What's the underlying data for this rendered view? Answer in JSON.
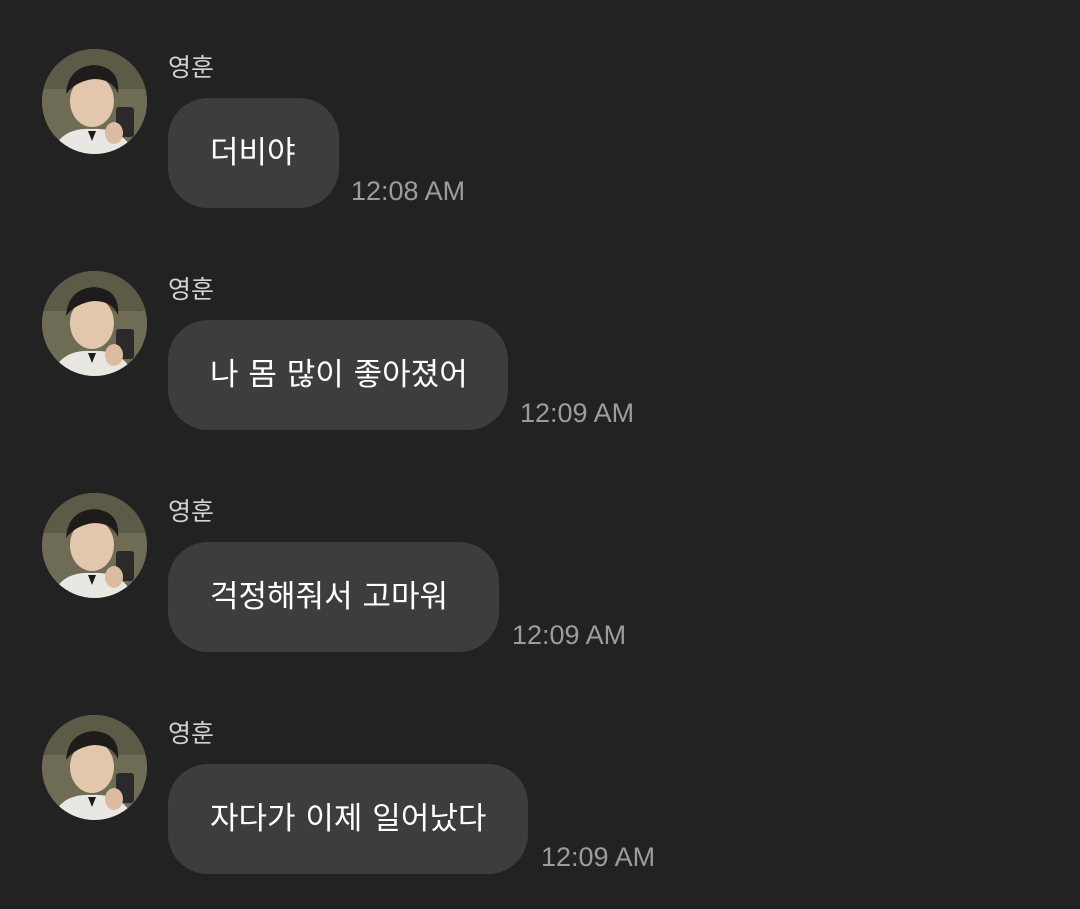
{
  "messages": [
    {
      "sender": "영훈",
      "text": "더비야",
      "time": "12:08 AM",
      "avatar_icon": "profile-photo"
    },
    {
      "sender": "영훈",
      "text": "나 몸 많이 좋아졌어",
      "time": "12:09 AM",
      "avatar_icon": "profile-photo"
    },
    {
      "sender": "영훈",
      "text": "걱정해줘서 고마워",
      "time": "12:09 AM",
      "avatar_icon": "profile-photo"
    },
    {
      "sender": "영훈",
      "text": "자다가 이제 일어났다",
      "time": "12:09 AM",
      "avatar_icon": "profile-photo"
    }
  ],
  "colors": {
    "background": "#232223",
    "bubble": "#3d3d3e",
    "text": "#ffffff",
    "sender": "#d2d2d2",
    "time": "#9c9c9c"
  }
}
